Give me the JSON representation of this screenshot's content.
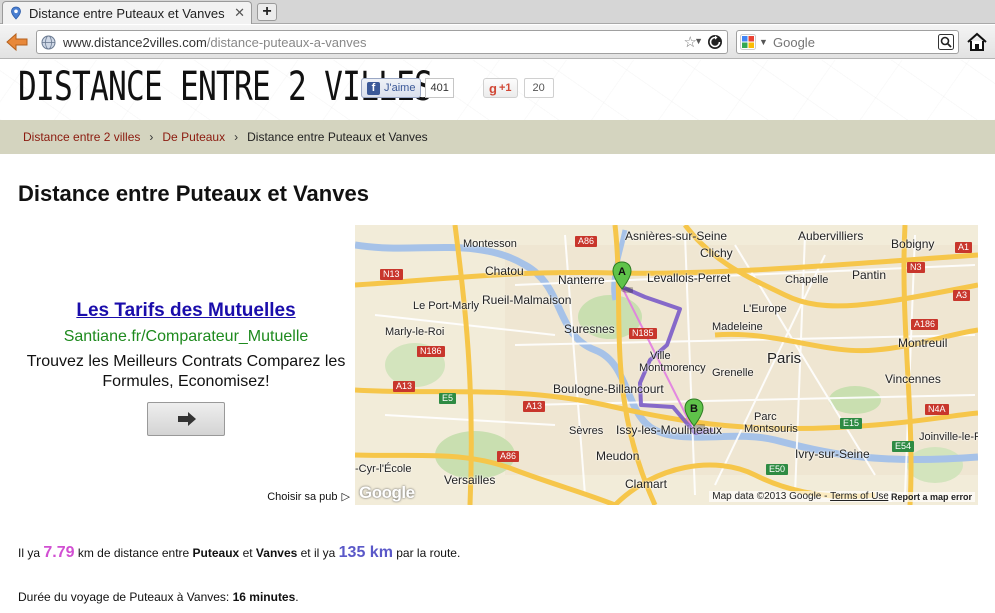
{
  "browser": {
    "tab_title": "Distance entre Puteaux et Vanves",
    "url_host": "www.distance2villes.com",
    "url_path": "/distance-puteaux-a-vanves",
    "search_placeholder": "Google"
  },
  "header": {
    "logo": "DISTANCE ENTRE 2 VILLES",
    "fb_like_label": "J'aime",
    "fb_like_count": "401",
    "gplus_label": "+1",
    "gplus_count": "20"
  },
  "breadcrumb": {
    "home": "Distance entre 2 villes",
    "sep": "›",
    "from": "De Puteaux",
    "current": "Distance entre Puteaux et Vanves"
  },
  "title": "Distance entre Puteaux et Vanves",
  "ad": {
    "title": "Les Tarifs des Mutuelles",
    "url": "Santiane.fr/Comparateur_Mutuelle",
    "description": "Trouvez les Meilleurs Contrats Comparez les Formules, Economisez!",
    "choice_label": "Choisir sa pub"
  },
  "map": {
    "places": {
      "asnieres": "Asnières-sur-Seine",
      "aubervilliers": "Aubervilliers",
      "bobigny": "Bobigny",
      "montesson": "Montesson",
      "clichy": "Clichy",
      "chatou": "Chatou",
      "nanterre": "Nanterre",
      "levallois": "Levallois-Perret",
      "chapelle": "Chapelle",
      "pantin": "Pantin",
      "rueil": "Rueil-Malmaison",
      "leportmarly": "Le Port-Marly",
      "leurope": "L'Europe",
      "suresnes": "Suresnes",
      "madeleine": "Madeleine",
      "marlyleroi": "Marly-le-Roi",
      "montreuil": "Montreuil",
      "paris": "Paris",
      "ville": "Ville",
      "montmorency": "Montmorency",
      "grenelle": "Grenelle",
      "vincennes": "Vincennes",
      "boulogne": "Boulogne-Billancourt",
      "parc": "Parc",
      "montsouris": "Montsouris",
      "sevres": "Sèvres",
      "issy": "Issy-les-Moulineaux",
      "joinville": "Joinville-le-Pont",
      "meudon": "Meudon",
      "ivry": "Ivry-sur-Seine",
      "cyr": "-Cyr-l'École",
      "versailles": "Versailles",
      "clamart": "Clamart"
    },
    "roads": {
      "a86_top": "A86",
      "n13": "N13",
      "n186": "N186",
      "n185": "N185",
      "a13_left": "A13",
      "e5": "E5",
      "a13_mid": "A13",
      "a86_bottom": "A86",
      "e50": "E50",
      "e15": "E15",
      "e54": "E54",
      "n4a": "N4A",
      "a186": "A186",
      "n3": "N3",
      "a3": "A3",
      "a1": "A1"
    },
    "marker_a": "A",
    "marker_b": "B",
    "google_logo": "Google",
    "attribution": "Map data ©2013 Google -",
    "terms": "Terms of Use",
    "report": "Report a map error",
    "route_color": "#7a5bc8",
    "direct_color": "#e27de2"
  },
  "summary": {
    "prefix": "Il ya ",
    "distance_fly": "7.79",
    "mid1": " km de distance entre ",
    "city_from": "Puteaux",
    "mid2": " et ",
    "city_to": "Vanves",
    "mid3": " et il ya ",
    "distance_road": "135 km",
    "suffix": " par la route."
  },
  "duration": {
    "prefix": "Durée du voyage de Puteaux à Vanves: ",
    "value": "16 minutes",
    "suffix": "."
  }
}
